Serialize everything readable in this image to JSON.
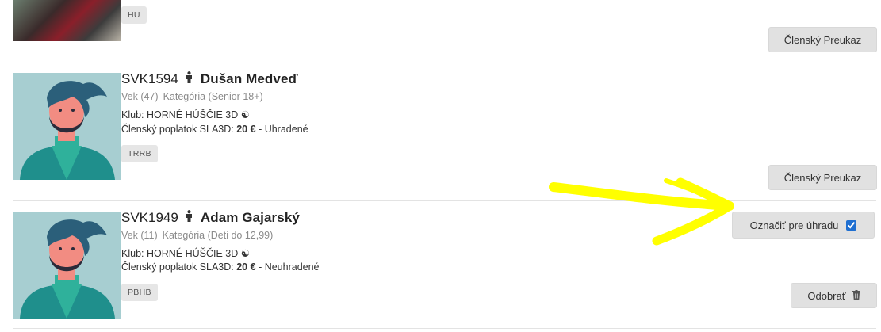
{
  "members": [
    {
      "tag": "HU",
      "button_label": "Členský Preukaz"
    },
    {
      "id": "SVK1594",
      "name": "Dušan Medveď",
      "age_label": "Vek (47)",
      "category_label": "Kategória (Senior 18+)",
      "club_prefix": "Klub:",
      "club_name": "HORNÉ HÚŠČIE 3D",
      "club_icon": "☯",
      "fee_prefix": "Členský poplatok SLA3D:",
      "fee_amount": "20 €",
      "fee_status": "- Uhradené",
      "tag": "TRRB",
      "button_label": "Členský Preukaz"
    },
    {
      "id": "SVK1949",
      "name": "Adam Gajarský",
      "age_label": "Vek (11)",
      "category_label": "Kategória (Deti do 12,99)",
      "club_prefix": "Klub:",
      "club_name": "HORNÉ HÚŠČIE 3D",
      "club_icon": "☯",
      "fee_prefix": "Členský poplatok SLA3D:",
      "fee_amount": "20 €",
      "fee_status": "- Neuhradené",
      "tag": "PBHB",
      "mark_label": "Označiť pre úhradu",
      "mark_checked": true,
      "remove_label": "Odobrať"
    }
  ],
  "colors": {
    "annotation_arrow": "#ffff00",
    "avatar_bg": "#a7ced1",
    "button_bg": "#e1e1e1",
    "tag_bg": "#e6e6e6"
  },
  "icons": [
    "person-icon",
    "trash-icon",
    "yin-yang-icon",
    "avatar-illustration"
  ]
}
